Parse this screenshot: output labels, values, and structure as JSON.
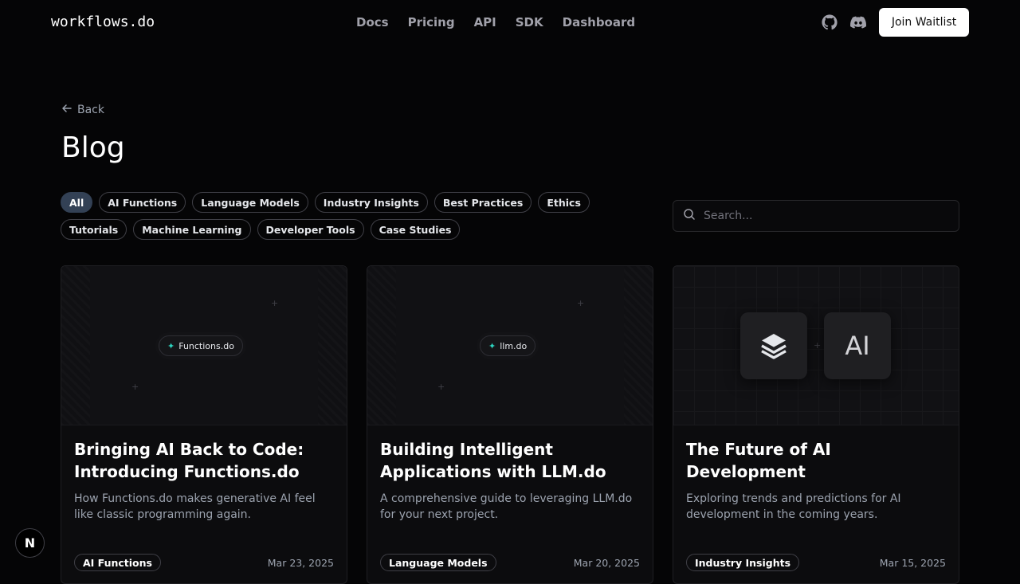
{
  "header": {
    "logo": "workflows.do",
    "nav": [
      "Docs",
      "Pricing",
      "API",
      "SDK",
      "Dashboard"
    ],
    "join_label": "Join Waitlist"
  },
  "page": {
    "back_label": "Back",
    "title": "Blog"
  },
  "filters": [
    "All",
    "AI Functions",
    "Language Models",
    "Industry Insights",
    "Best Practices",
    "Ethics",
    "Tutorials",
    "Machine Learning",
    "Developer Tools",
    "Case Studies"
  ],
  "active_filter": "All",
  "search": {
    "placeholder": "Search..."
  },
  "posts": [
    {
      "badge": "Functions.do",
      "title": "Bringing AI Back to Code: Introducing Functions.do",
      "description": "How Functions.do makes generative AI feel like classic programming again.",
      "tag": "AI Functions",
      "date": "Mar 23, 2025"
    },
    {
      "badge": "llm.do",
      "title": "Building Intelligent Applications with LLM.do",
      "description": "A comprehensive guide to leveraging LLM.do for your next project.",
      "tag": "Language Models",
      "date": "Mar 20, 2025"
    },
    {
      "badge": "AI",
      "title": "The Future of AI Development",
      "description": "Exploring trends and predictions for AI development in the coming years.",
      "tag": "Industry Insights",
      "date": "Mar 15, 2025"
    }
  ],
  "floating_badge": "N",
  "colors": {
    "accent": "#2dd4bf",
    "active_filter_bg": "#334155",
    "background": "#050506"
  }
}
